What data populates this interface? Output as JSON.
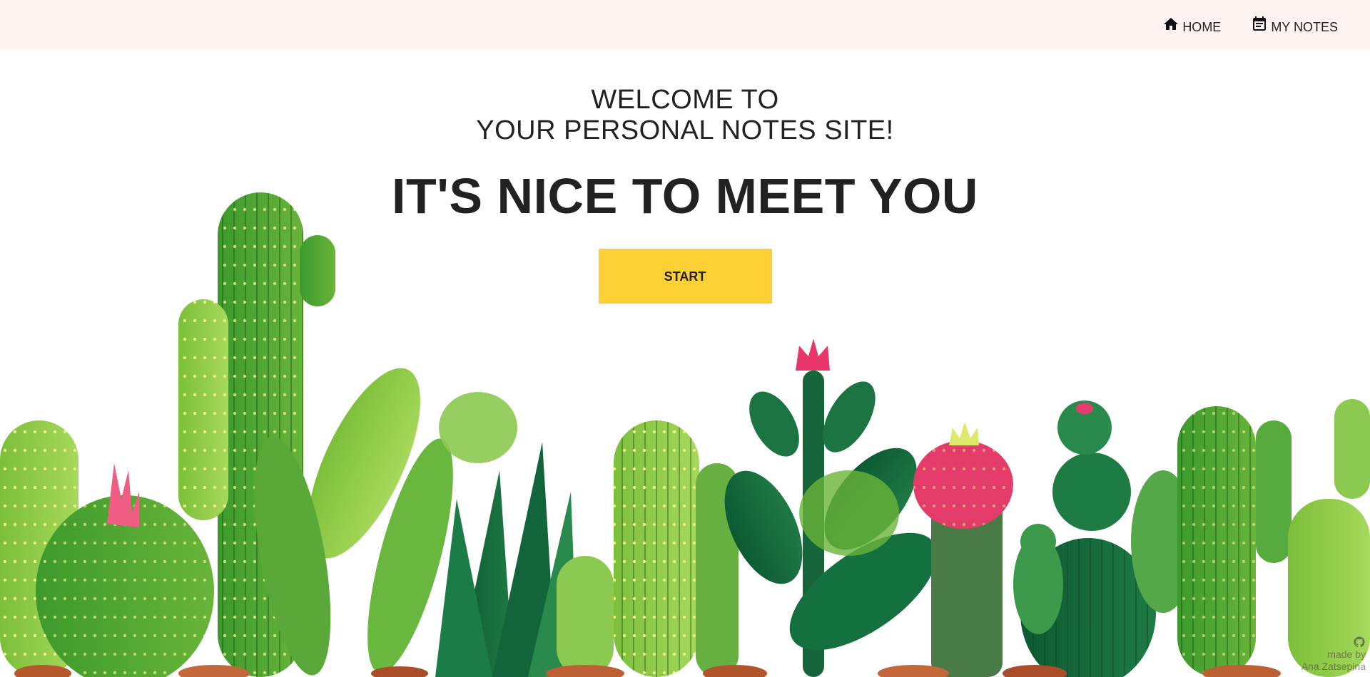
{
  "nav": {
    "items": [
      {
        "label": "HOME",
        "icon": "home-icon"
      },
      {
        "label": "MY NOTES",
        "icon": "notes-icon"
      }
    ]
  },
  "hero": {
    "welcome_line1": "WELCOME TO",
    "welcome_line2": "YOUR PERSONAL NOTES SITE!",
    "headline": "IT'S NICE TO MEET YOU",
    "start_label": "START"
  },
  "credit": {
    "line1": "made by",
    "line2": "Ana Zatsepina",
    "icon": "github-icon"
  },
  "colors": {
    "navbar_bg": "#fdf3f1",
    "button_bg": "#fdd036",
    "text": "#222222"
  }
}
